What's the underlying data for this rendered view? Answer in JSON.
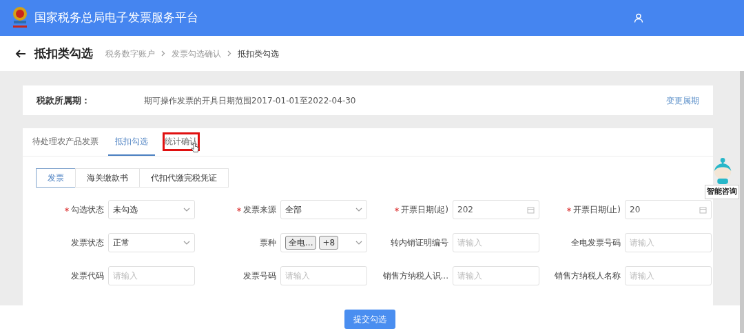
{
  "header": {
    "title": "国家税务总局电子发票服务平台"
  },
  "page": {
    "title": "抵扣类勾选",
    "breadcrumb": [
      {
        "label": "税务数字账户",
        "current": false
      },
      {
        "label": "发票勾选确认",
        "current": false
      },
      {
        "label": "抵扣类勾选",
        "current": true
      }
    ]
  },
  "period": {
    "label": "税款所属期：",
    "value": "期可操作发票的开具日期范围2017-01-01至2022-04-30",
    "link": "变更属期"
  },
  "tabs": [
    {
      "label": "待处理农产品发票",
      "selected": false,
      "highlighted": false
    },
    {
      "label": "抵扣勾选",
      "selected": true,
      "highlighted": false
    },
    {
      "label": "统计确认",
      "selected": false,
      "highlighted": true
    }
  ],
  "sub_tabs": [
    {
      "label": "发票",
      "selected": true
    },
    {
      "label": "海关缴款书",
      "selected": false
    },
    {
      "label": "代扣代缴完税凭证",
      "selected": false
    }
  ],
  "fields": [
    {
      "label": "勾选状态",
      "required": true,
      "kind": "select",
      "value": "未勾选"
    },
    {
      "label": "发票来源",
      "required": true,
      "kind": "select",
      "value": "全部"
    },
    {
      "label": "开票日期(起)",
      "required": true,
      "kind": "date",
      "value": "202"
    },
    {
      "label": "开票日期(止)",
      "required": true,
      "kind": "date",
      "value": "20"
    },
    {
      "label": "发票状态",
      "required": false,
      "kind": "select",
      "value": "正常"
    },
    {
      "label": "票种",
      "required": false,
      "kind": "tags",
      "tags": [
        "全电...",
        "+8"
      ]
    },
    {
      "label": "转内销证明编号",
      "required": false,
      "kind": "input",
      "placeholder": "请输入"
    },
    {
      "label": "全电发票号码",
      "required": false,
      "kind": "input",
      "placeholder": "请输入"
    },
    {
      "label": "发票代码",
      "required": false,
      "kind": "input",
      "placeholder": "请输入"
    },
    {
      "label": "发票号码",
      "required": false,
      "kind": "input",
      "placeholder": "请输入"
    },
    {
      "label": "销售方纳税人识...",
      "required": false,
      "kind": "input",
      "placeholder": "请输入"
    },
    {
      "label": "销售方纳税人名称",
      "required": false,
      "kind": "input",
      "placeholder": "请输入"
    }
  ],
  "assistant": {
    "label": "智能咨询"
  },
  "footer": {
    "submit": "提交勾选"
  }
}
